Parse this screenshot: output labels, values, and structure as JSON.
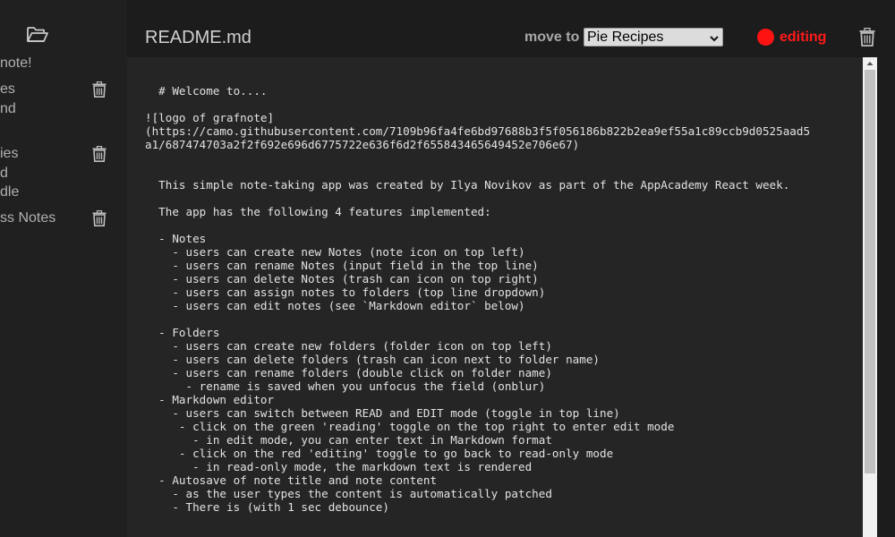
{
  "sidebar": {
    "open_folder_icon": "folder-open-icon",
    "trash_icon": "trash-icon",
    "fragments": [
      "note!",
      "es",
      "nd",
      "ies",
      "d",
      "dle",
      "ss Notes"
    ]
  },
  "header": {
    "note_title": "README.md",
    "move_label": "move to",
    "folder_selected": "Pie Recipes",
    "mode_label": "editing",
    "mode_color": "#ff1212",
    "delete_icon": "trash-icon"
  },
  "editor": {
    "content": "  # Welcome to....\n\n![logo of grafnote]\n(https://camo.githubusercontent.com/7109b96fa4fe6bd97688b3f5f056186b822b2ea9ef55a1c89ccb9d0525aad5\na1/687474703a2f2f692e696d6775722e636f6d2f655843465649452e706e67)\n\n\n  This simple note-taking app was created by Ilya Novikov as part of the AppAcademy React week.\n\n  The app has the following 4 features implemented:\n\n  - Notes\n    - users can create new Notes (note icon on top left)\n    - users can rename Notes (input field in the top line)\n    - users can delete Notes (trash can icon on top right)\n    - users can assign notes to folders (top line dropdown)\n    - users can edit notes (see `Markdown editor` below)\n\n  - Folders\n    - users can create new folders (folder icon on top left)\n    - users can delete folders (trash can icon next to folder name)\n    - users can rename folders (double click on folder name)\n      - rename is saved when you unfocus the field (onblur)\n  - Markdown editor\n    - users can switch between READ and EDIT mode (toggle in top line)\n     - click on the green 'reading' toggle on the top right to enter edit mode\n       - in edit mode, you can enter text in Markdown format\n     - click on the red 'editing' toggle to go back to read-only mode\n       - in read-only mode, the markdown text is rendered\n  - Autosave of note title and note content\n    - as the user types the content is automatically patched\n    - There is (with 1 sec debounce)"
  }
}
